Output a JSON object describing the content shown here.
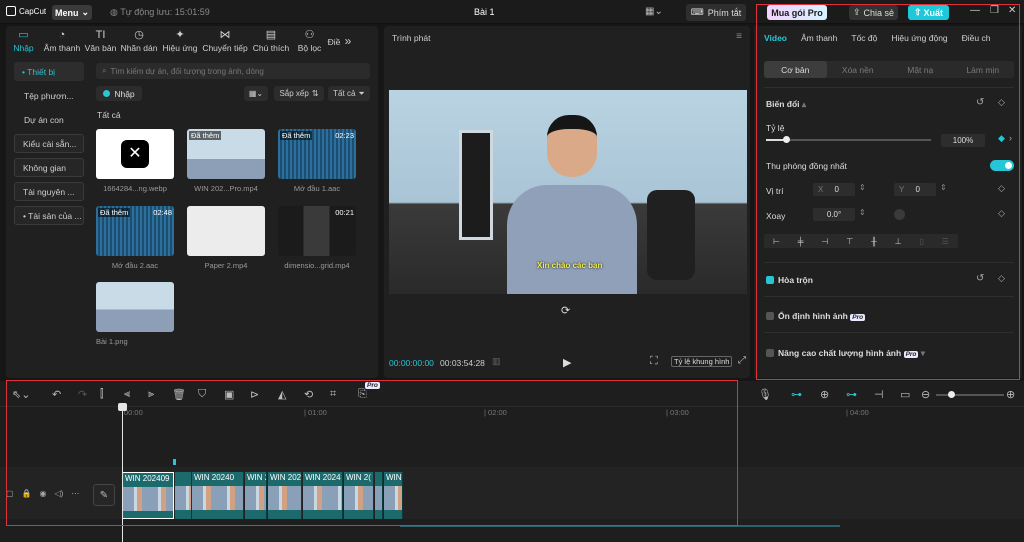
{
  "titlebar": {
    "app_name": "CapCut",
    "menu_label": "Menu",
    "autosave": "Tự động lưu: 15:01:59",
    "project_title": "Bài 1",
    "shortcut_label": "Phím tắt",
    "pro_label": "Mua gói Pro",
    "share_label": "Chia sẻ",
    "export_label": "Xuất"
  },
  "left": {
    "tabs": [
      {
        "label": "Nhập",
        "icon": "▭"
      },
      {
        "label": "Âm thanh",
        "icon": "◔"
      },
      {
        "label": "Văn bản",
        "icon": "TI"
      },
      {
        "label": "Nhãn dán",
        "icon": "◷"
      },
      {
        "label": "Hiệu ứng",
        "icon": "✦"
      },
      {
        "label": "Chuyển tiếp",
        "icon": "⋈"
      },
      {
        "label": "Chú thích",
        "icon": "▤"
      },
      {
        "label": "Bộ lọc",
        "icon": "⚇"
      },
      {
        "label": "Điề",
        "icon": ""
      }
    ],
    "sidebar": [
      "• Thiết bị",
      "Tệp phươn...",
      "Dự án con",
      "Kiểu cài sẵn...",
      "Không gian",
      "Tài nguyên ...",
      "• Tài sản của ..."
    ],
    "search_placeholder": "Tìm kiếm dự án, đối tượng trong ảnh, dòng",
    "import_label": "Nhập",
    "sort_label": "Sắp xếp",
    "all_filter": "Tất cả",
    "all_heading": "Tất cả",
    "media": [
      {
        "name": "1664284...ng.webp",
        "added": "",
        "duration": ""
      },
      {
        "name": "WIN 202...Pro.mp4",
        "added": "Đã thêm",
        "duration": ""
      },
      {
        "name": "Mở đầu 1.aac",
        "added": "Đã thêm",
        "duration": "02:23"
      },
      {
        "name": "Mở đầu 2.aac",
        "added": "Đã thêm",
        "duration": "02:48"
      },
      {
        "name": "Paper 2.mp4",
        "added": "",
        "duration": ""
      },
      {
        "name": "dimensio...grid.mp4",
        "added": "",
        "duration": "00:21"
      },
      {
        "name": "Bài 1.png",
        "added": "",
        "duration": ""
      }
    ]
  },
  "player": {
    "title": "Trình phát",
    "subtitle_text": "Xin chào các bạn",
    "current_time": "00:00:00:00",
    "total_time": "00:03:54:28",
    "ratio_label": "Tỷ lệ khung hình"
  },
  "inspector": {
    "tabs": [
      "Video",
      "Âm thanh",
      "Tốc độ",
      "Hiệu ứng động",
      "Điều ch"
    ],
    "subtabs": [
      "Cơ bản",
      "Xóa nền",
      "Mặt nạ",
      "Làm mịn"
    ],
    "transform_label": "Biến đổi",
    "scale_label": "Tỷ lệ",
    "scale_value": "100%",
    "scale_fraction": 0.12,
    "uniform_label": "Thu phóng đồng nhất",
    "position_label": "Vị trí",
    "pos_x_label": "X",
    "pos_x": "0",
    "pos_y_label": "Y",
    "pos_y": "0",
    "rotate_label": "Xoay",
    "rotate_value": "0.0°",
    "blend_label": "Hòa trộn",
    "stabilize_label": "Ổn định hình ảnh",
    "enhance_label": "Nâng cao chất lượng hình ảnh",
    "pro_badge": "Pro"
  },
  "timeline": {
    "ticks": [
      "00:00",
      "| 01:00",
      "| 02:00",
      "| 03:00",
      "| 04:00"
    ],
    "clip_labels": [
      "WIN 202409",
      "WIN 20240",
      "WIN 2",
      "WIN 202",
      "WIN 2024",
      "WIN 2(",
      "WIN"
    ],
    "pro_badge": "Pro"
  },
  "colors": {
    "accent": "#27c6d6",
    "highlight_box": "#e0313a",
    "clip": "#1d6a6d"
  }
}
